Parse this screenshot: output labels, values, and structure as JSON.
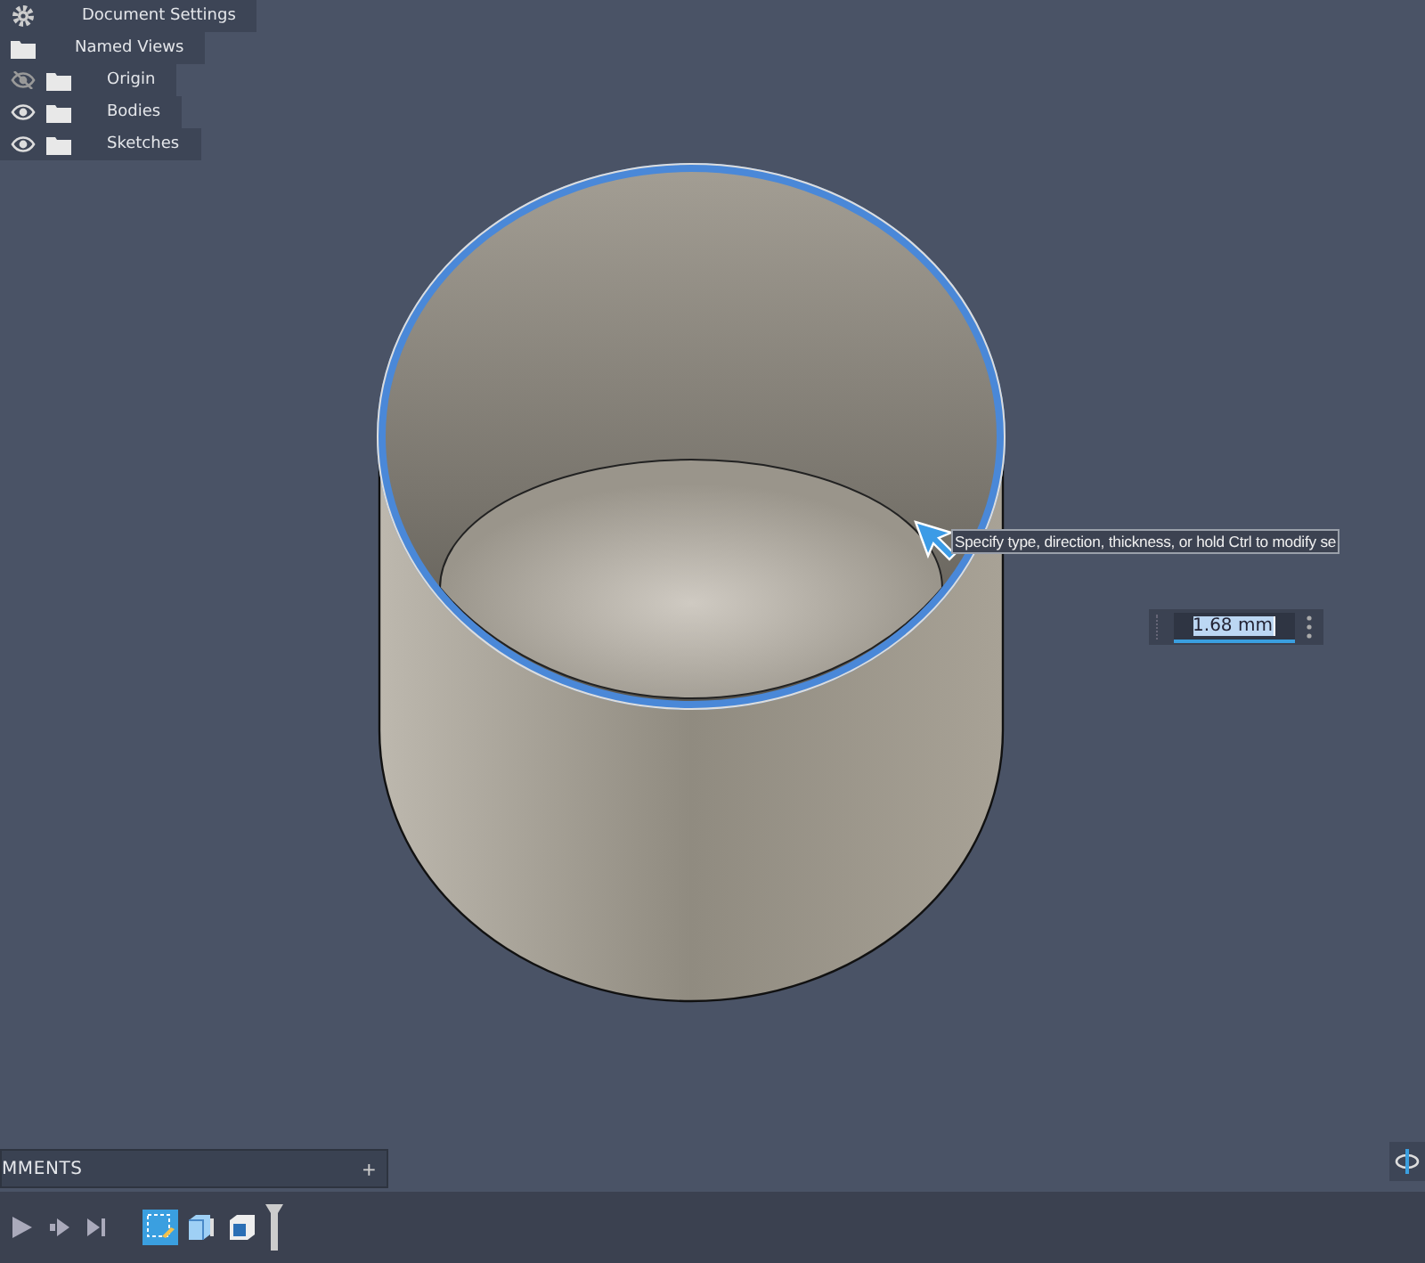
{
  "browser": {
    "items": [
      {
        "kind": "settings",
        "label": "Document Settings"
      },
      {
        "kind": "views",
        "label": "Named Views"
      },
      {
        "kind": "folder",
        "label": "Origin",
        "visible": false
      },
      {
        "kind": "folder",
        "label": "Bodies",
        "visible": true
      },
      {
        "kind": "folder",
        "label": "Sketches",
        "visible": true
      }
    ]
  },
  "tooltip": "Specify type, direction, thickness, or hold Ctrl to modify se",
  "dimension": {
    "value": "1.68 mm"
  },
  "comments": {
    "title": "MMENTS",
    "add": "+"
  },
  "timeline": {
    "items": [
      {
        "kind": "sketch",
        "selected": true
      },
      {
        "kind": "body",
        "selected": false
      },
      {
        "kind": "shell",
        "selected": false
      }
    ]
  }
}
